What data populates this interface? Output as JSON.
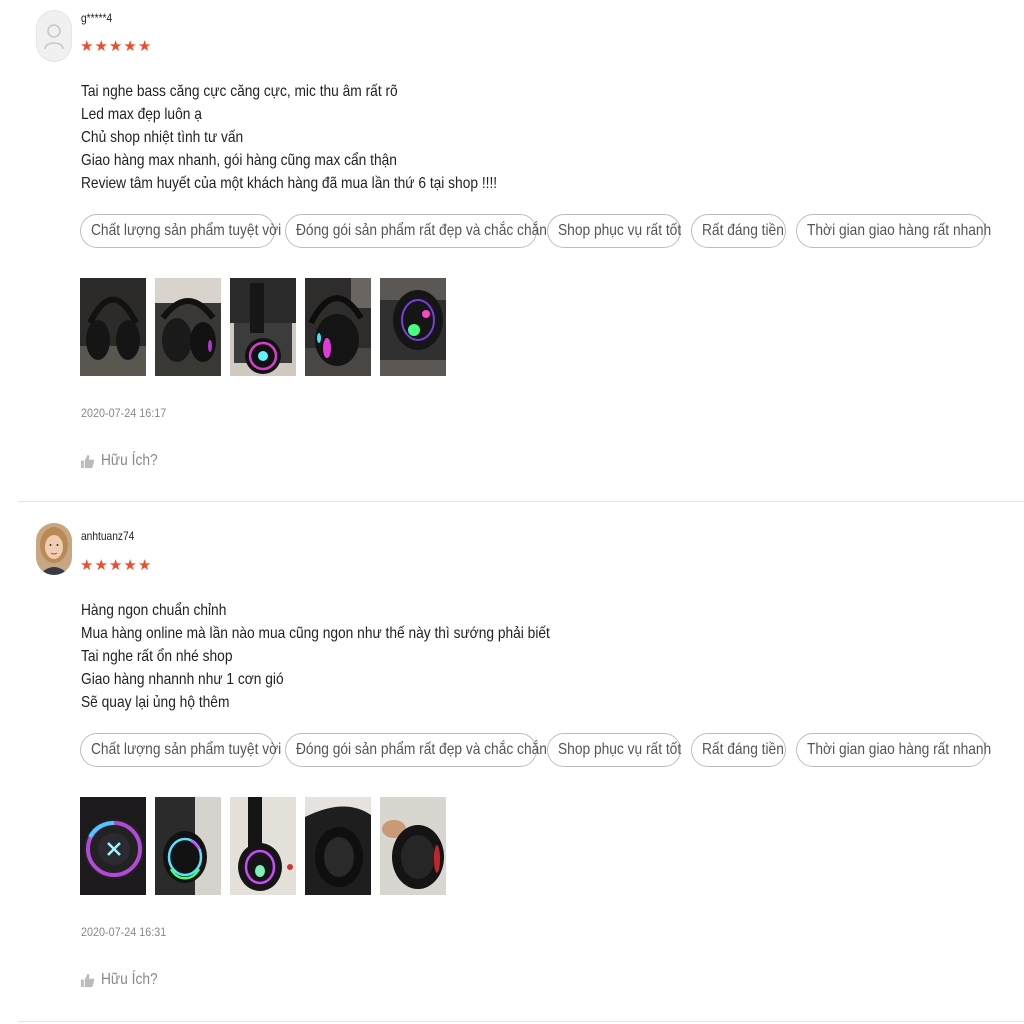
{
  "reviews": [
    {
      "username": "g*****4",
      "rating": 5,
      "comment_lines": [
        "Tai nghe bass căng cực căng cực, mic thu âm rất rõ",
        "Led max đẹp luôn ạ",
        "Chủ shop nhiệt tình tư vấn",
        "Giao hàng max nhanh, gói hàng cũng max cẩn thận",
        "Review tâm huyết của một khách hàng đã mua lần thứ 6 tại shop !!!!"
      ],
      "tags": [
        "Chất lượng sản phẩm tuyệt vời",
        "Đóng gói sản phẩm rất đẹp và chắc chắn",
        "Shop phục vụ rất tốt",
        "Rất đáng tiền",
        "Thời gian giao hàng rất nhanh"
      ],
      "date": "2020-07-24 16:17",
      "helpful_label": "Hữu Ích?"
    },
    {
      "username": "anhtuanz74",
      "rating": 5,
      "comment_lines": [
        "Hàng ngon chuẩn chỉnh",
        "Mua hàng online mà lần nào mua cũng ngon như thế này thì sướng phải biết",
        "Tai nghe rất ổn nhé shop",
        "Giao hàng nhannh như 1 cơn gió",
        "Sẽ quay lại ủng hộ thêm"
      ],
      "tags": [
        "Chất lượng sản phẩm tuyệt vời",
        "Đóng gói sản phẩm rất đẹp và chắc chắn",
        "Shop phục vụ rất tốt",
        "Rất đáng tiền",
        "Thời gian giao hàng rất nhanh"
      ],
      "date": "2020-07-24 16:31",
      "helpful_label": "Hữu Ích?"
    }
  ],
  "colors": {
    "star": "#ee4d2d",
    "tag_border": "#bdbdbd",
    "muted": "#888888"
  }
}
